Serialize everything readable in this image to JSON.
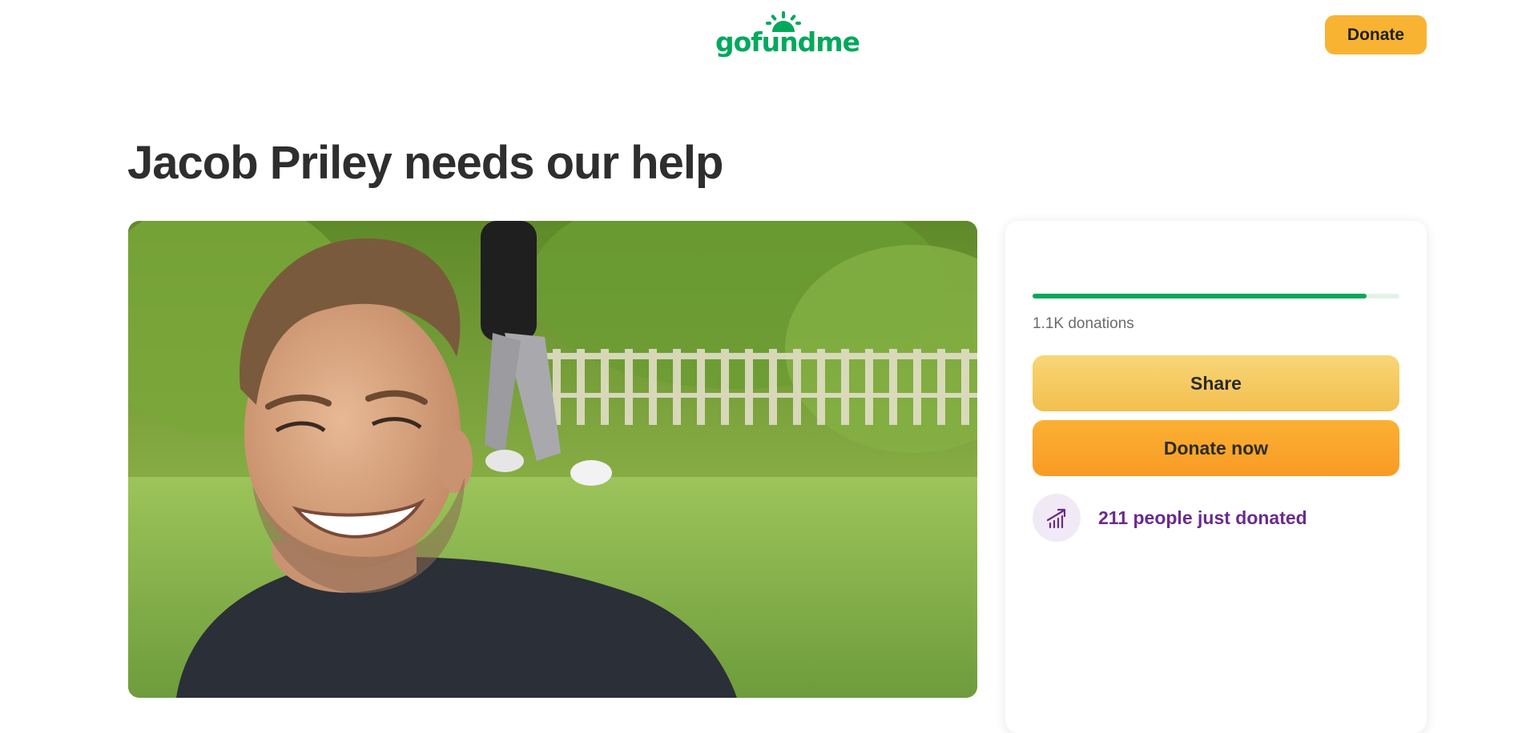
{
  "colors": {
    "brand": "#02a95c",
    "accent": "#6b2a8e",
    "button_yellow": "#f9b332"
  },
  "header": {
    "logo_text": "gofundme",
    "logo_icon": "sun-icon",
    "donate_label": "Donate"
  },
  "page": {
    "title": "Jacob Priley needs our help"
  },
  "hero": {
    "image": "campaign-photo"
  },
  "card": {
    "progress_fraction": 0.91,
    "donation_count": "1.1K donations",
    "share_label": "Share",
    "donate_now_label": "Donate now",
    "recent_icon": "trending-up-icon",
    "recent_text": "211 people just donated"
  }
}
